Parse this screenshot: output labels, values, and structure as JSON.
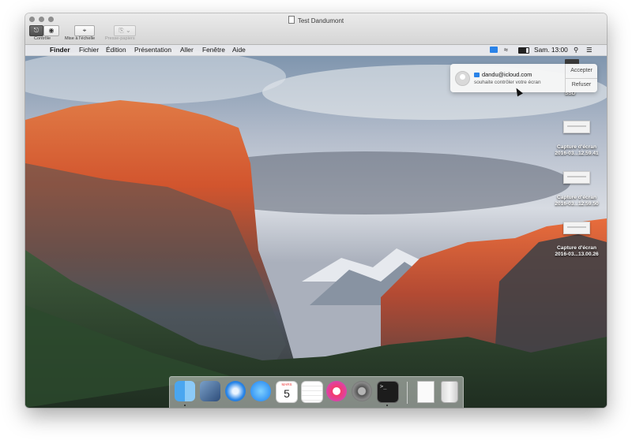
{
  "window": {
    "title": "Test Dandumont"
  },
  "toolbar": {
    "control_label": "Contrôle",
    "scale_label": "Mise à l'échelle",
    "clipboard_label": "Presse-papiers"
  },
  "menubar": {
    "apple_glyph": "",
    "app_name": "Finder",
    "items": [
      "Fichier",
      "Édition",
      "Présentation",
      "Aller",
      "Fenêtre",
      "Aide"
    ],
    "clock": "Sam. 13:00",
    "status_icons": [
      "screen-sharing-icon",
      "wifi-icon",
      "battery-icon",
      "spotlight-icon",
      "notification-center-icon"
    ]
  },
  "notification": {
    "title": "dandu@icloud.com",
    "subtitle": "souhaite contrôler votre écran",
    "accept_label": "Accepter",
    "decline_label": "Refuser"
  },
  "desktop": {
    "partial_label": "SSD",
    "items": [
      {
        "line1": "Capture d'écran",
        "line2": "2016-03...12.59.41"
      },
      {
        "line1": "Capture d'écran",
        "line2": "2016-03...12.59.50"
      },
      {
        "line1": "Capture d'écran",
        "line2": "2016-03...13.00.26"
      }
    ]
  },
  "dock": {
    "calendar_month": "MARS",
    "calendar_day": "5",
    "apps": [
      "finder-icon",
      "preview-icon",
      "safari-icon",
      "messages-icon",
      "calendar-icon",
      "reminders-icon",
      "itunes-icon",
      "system-preferences-icon",
      "terminal-icon",
      "document-icon",
      "trash-icon"
    ]
  },
  "colors": {
    "accent": "#1b7cf2",
    "menubar": "#eeeef0",
    "titlebar": "#dcdcdc",
    "itunes": "#f53a6b",
    "terminal": "#1c1c1c"
  }
}
